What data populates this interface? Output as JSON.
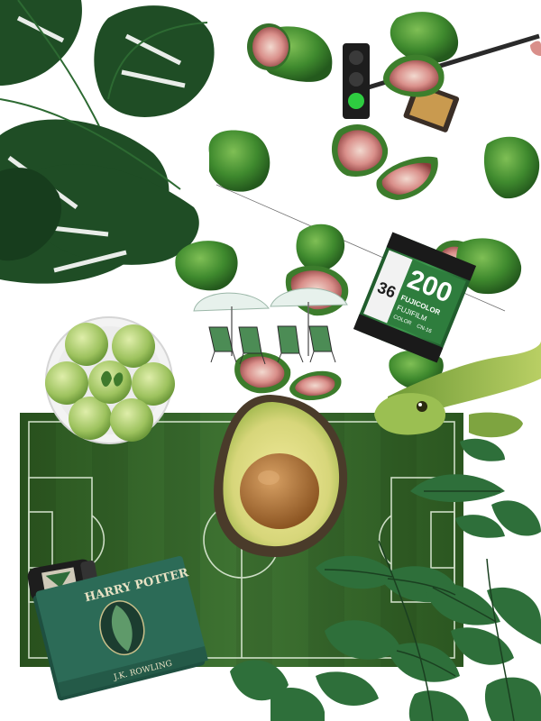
{
  "collage": {
    "film_canister": {
      "speed": "200",
      "exposures": "36",
      "brand": "FUJICOLOR",
      "line2": "FUJIFILM",
      "line3": "COLOR",
      "line4": "CN-16"
    },
    "book": {
      "series": "HARRY POTTER",
      "author": "J.K. ROWLING"
    },
    "colors": {
      "pitch_dark": "#2f5a23",
      "pitch_light": "#3d7030",
      "leaf": "#1f4d25",
      "fig_skin": "#3f8a2e",
      "fig_flesh": "#c97a7a",
      "apple": "#a7c96a",
      "avocado_flesh": "#d7d67a",
      "avocado_pit": "#a66a2c",
      "snake": "#8fb04a",
      "book_cover": "#2c6b57",
      "film_green": "#2e7d3d"
    },
    "icons": [
      "monstera-leaf-icon",
      "fig-icon",
      "traffic-light-icon",
      "beach-umbrella-icon",
      "film-roll-icon",
      "apple-plate-icon",
      "snake-icon",
      "avocado-icon",
      "potion-bottle-icon",
      "book-icon",
      "ficus-leaves-icon"
    ]
  }
}
